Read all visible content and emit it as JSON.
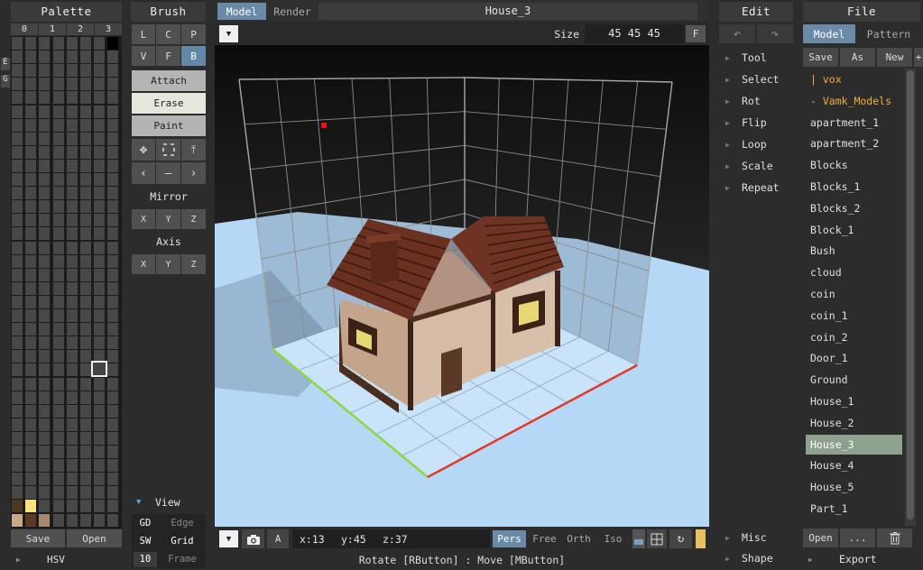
{
  "palette": {
    "title": "Palette",
    "col_headers": [
      "0",
      "1",
      "2",
      "3"
    ],
    "side_tabs": [
      "E",
      "G"
    ],
    "swatches": [
      "#4a3a22",
      "#f7e27a",
      "#c9a98a",
      "#5a3a22",
      "#a58a70"
    ],
    "save_label": "Save",
    "open_label": "Open",
    "hsv_label": "HSV"
  },
  "brush": {
    "title": "Brush",
    "mode_row1": [
      "L",
      "C",
      "P"
    ],
    "mode_row2": [
      "V",
      "F",
      "B"
    ],
    "attach_label": "Attach",
    "erase_label": "Erase",
    "paint_label": "Paint",
    "mirror_label": "Mirror",
    "mirror_axes": [
      "X",
      "Y",
      "Z"
    ],
    "axis_label": "Axis",
    "axis_axes": [
      "X",
      "Y",
      "Z"
    ]
  },
  "view": {
    "label": "View",
    "gd": "GD",
    "edge": "Edge",
    "sw": "SW",
    "grid": "Grid",
    "frame_num": "10",
    "frame": "Frame"
  },
  "tabs": {
    "model": "Model",
    "render": "Render",
    "title": "House_3"
  },
  "size": {
    "label": "Size",
    "value": "45 45 45",
    "f_btn": "F"
  },
  "bottombar": {
    "coords": {
      "x": "x:13",
      "y": "y:45",
      "z": "z:37"
    },
    "a_btn": "A",
    "projections": [
      "Pers",
      "Free",
      "Orth",
      "Iso"
    ],
    "status": "Rotate [RButton] : Move [MButton]"
  },
  "edit": {
    "title": "Edit",
    "undo_icon": "undo-icon",
    "redo_icon": "redo-icon",
    "items": [
      "Tool",
      "Select",
      "Rot",
      "Flip",
      "Loop",
      "Scale",
      "Repeat"
    ],
    "misc": "Misc",
    "shape": "Shape"
  },
  "file": {
    "title": "File",
    "tab_model": "Model",
    "tab_pattern": "Pattern",
    "save": "Save",
    "as": "As",
    "new": "New",
    "plus": "+",
    "items": [
      "| vox",
      "- Vamk_Models",
      "apartment_1",
      "apartment_2",
      "Blocks",
      "Blocks_1",
      "Blocks_2",
      "Block_1",
      "Bush",
      "cloud",
      "coin",
      "coin_1",
      "coin_2",
      "Door_1",
      "Ground",
      "House_1",
      "House_2",
      "House_3",
      "House_4",
      "House_5",
      "Part_1"
    ],
    "selected": "House_3",
    "open": "Open",
    "more": "...",
    "export": "Export"
  },
  "colors": {
    "accent": "#5e86a8",
    "selected": "#8ea08e",
    "folder": "#f0b040"
  }
}
